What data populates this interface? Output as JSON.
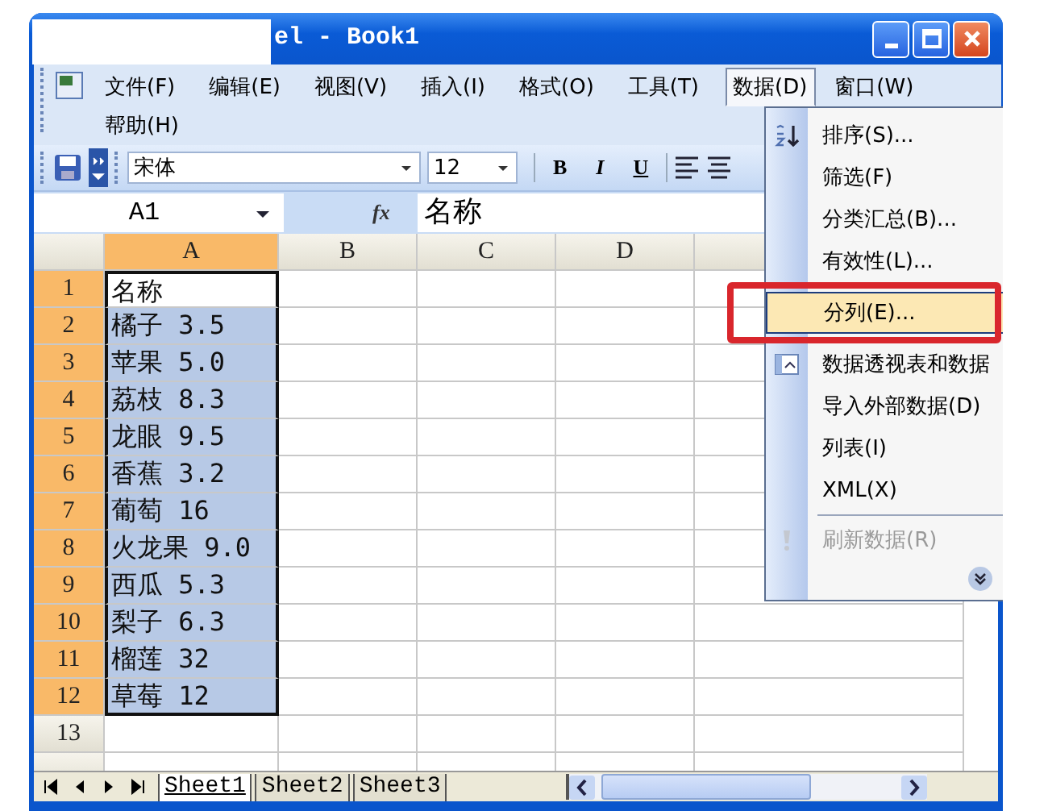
{
  "window": {
    "title": "el - Book1"
  },
  "menu_bar": [
    {
      "label": "文件(F)",
      "selected": false
    },
    {
      "label": "编辑(E)",
      "selected": false
    },
    {
      "label": "视图(V)",
      "selected": false
    },
    {
      "label": "插入(I)",
      "selected": false
    },
    {
      "label": "格式(O)",
      "selected": false
    },
    {
      "label": "工具(T)",
      "selected": false
    },
    {
      "label": "数据(D)",
      "selected": true
    },
    {
      "label": "窗口(W)",
      "selected": false
    },
    {
      "label": "帮助(H)",
      "selected": false
    }
  ],
  "toolbar": {
    "font": "宋体",
    "size": "12",
    "buttons": [
      "B",
      "I",
      "U"
    ]
  },
  "formula_bar": {
    "name_box": "A1",
    "function_label": "fx",
    "formula": "名称"
  },
  "sheet": {
    "columns": [
      {
        "label": "A",
        "selected": true
      },
      {
        "label": "B",
        "selected": false
      },
      {
        "label": "C",
        "selected": false
      },
      {
        "label": "D",
        "selected": false
      }
    ],
    "rows": [
      {
        "label": "1",
        "selected": true,
        "active": true,
        "cell": "名称"
      },
      {
        "label": "2",
        "selected": true,
        "active": false,
        "cell": "橘子 3.5"
      },
      {
        "label": "3",
        "selected": true,
        "active": false,
        "cell": "苹果 5.0"
      },
      {
        "label": "4",
        "selected": true,
        "active": false,
        "cell": "荔枝 8.3"
      },
      {
        "label": "5",
        "selected": true,
        "active": false,
        "cell": "龙眼 9.5"
      },
      {
        "label": "6",
        "selected": true,
        "active": false,
        "cell": "香蕉 3.2"
      },
      {
        "label": "7",
        "selected": true,
        "active": false,
        "cell": "葡萄 16"
      },
      {
        "label": "8",
        "selected": true,
        "active": false,
        "cell": "火龙果 9.0"
      },
      {
        "label": "9",
        "selected": true,
        "active": false,
        "cell": "西瓜 5.3"
      },
      {
        "label": "10",
        "selected": true,
        "active": false,
        "cell": "梨子 6.3"
      },
      {
        "label": "11",
        "selected": true,
        "active": false,
        "cell": "榴莲 32"
      },
      {
        "label": "12",
        "selected": true,
        "active": false,
        "cell": "草莓 12"
      },
      {
        "label": "13",
        "selected": false,
        "active": false
      }
    ]
  },
  "sheet_tabs": [
    {
      "label": "Sheet1",
      "selected": true
    },
    {
      "label": "Sheet2",
      "selected": false
    },
    {
      "label": "Sheet3",
      "selected": false
    }
  ],
  "data_menu": [
    {
      "kind": "command",
      "label": "排序(S)...",
      "highlighted": false,
      "annotated": false,
      "disabled": false
    },
    {
      "kind": "command",
      "label": "筛选(F)",
      "highlighted": false,
      "annotated": false,
      "disabled": false
    },
    {
      "kind": "command",
      "label": "分类汇总(B)...",
      "highlighted": false,
      "annotated": false,
      "disabled": false
    },
    {
      "kind": "command",
      "label": "有效性(L)...",
      "highlighted": false,
      "annotated": false,
      "disabled": false
    },
    {
      "kind": "command",
      "label": "分列(E)...",
      "highlighted": true,
      "annotated": true,
      "disabled": false
    },
    {
      "kind": "command",
      "label": "数据透视表和数据",
      "highlighted": false,
      "annotated": false,
      "disabled": false
    },
    {
      "kind": "command",
      "label": "导入外部数据(D)",
      "highlighted": false,
      "annotated": false,
      "disabled": false
    },
    {
      "kind": "command",
      "label": "列表(I)",
      "highlighted": false,
      "annotated": false,
      "disabled": false
    },
    {
      "kind": "command",
      "label": "XML(X)",
      "highlighted": false,
      "annotated": false,
      "disabled": false
    },
    {
      "kind": "separator"
    },
    {
      "kind": "command",
      "label": "刷新数据(R)",
      "highlighted": false,
      "annotated": false,
      "disabled": true
    },
    {
      "kind": "more"
    }
  ]
}
